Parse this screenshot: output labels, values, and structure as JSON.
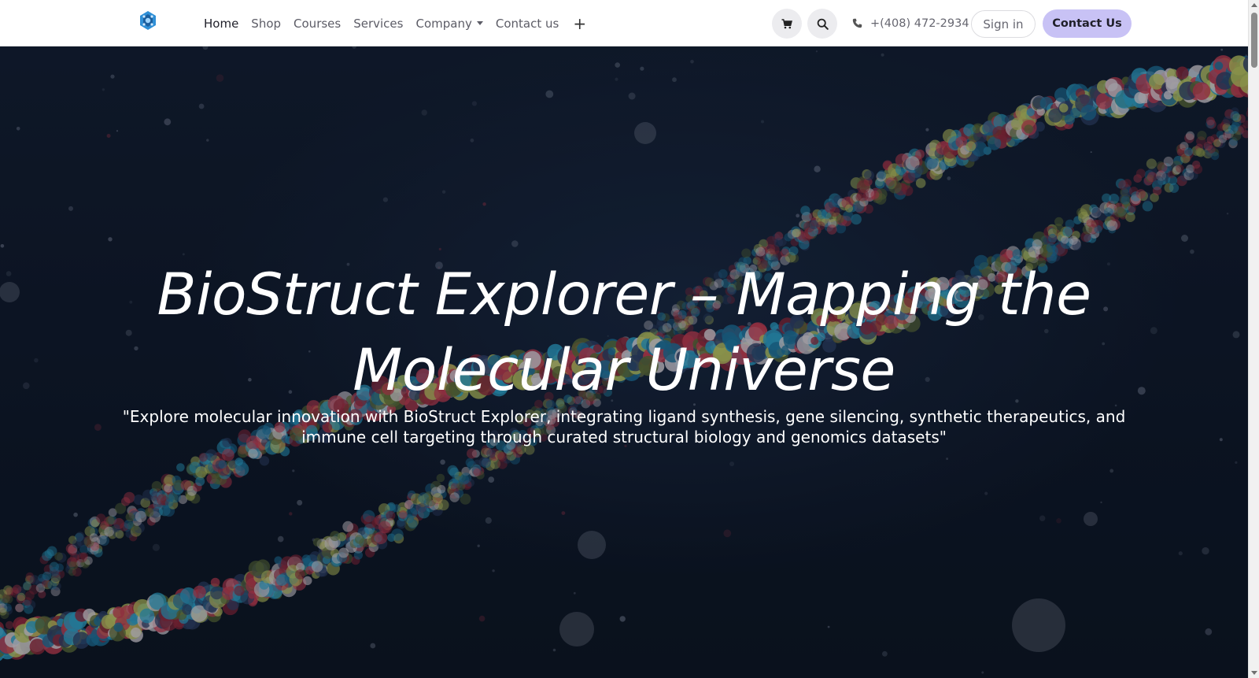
{
  "navbar": {
    "logo_name": "molecule-logo",
    "links": [
      {
        "label": "Home",
        "active": true
      },
      {
        "label": "Shop"
      },
      {
        "label": "Courses"
      },
      {
        "label": "Services"
      },
      {
        "label": "Company",
        "dropdown": true
      },
      {
        "label": "Contact us"
      }
    ],
    "plus_label": "+",
    "cart_icon": "cart-icon",
    "search_icon": "search-icon",
    "phone_number": "+(408) 472-2934",
    "signin_label": "Sign in",
    "contact_button_label": "Contact Us",
    "accent_color": "#c8c2f5"
  },
  "hero": {
    "title": "BioStruct Explorer – Mapping the Molecular Universe",
    "subtitle": "\"Explore molecular innovation with BioStruct Explorer, integrating ligand synthesis, gene silencing, synthetic therapeutics, and immune cell targeting through curated structural biology and genomics datasets\"",
    "background_image": "DNA double helix made of colorful spheres on dark background"
  }
}
